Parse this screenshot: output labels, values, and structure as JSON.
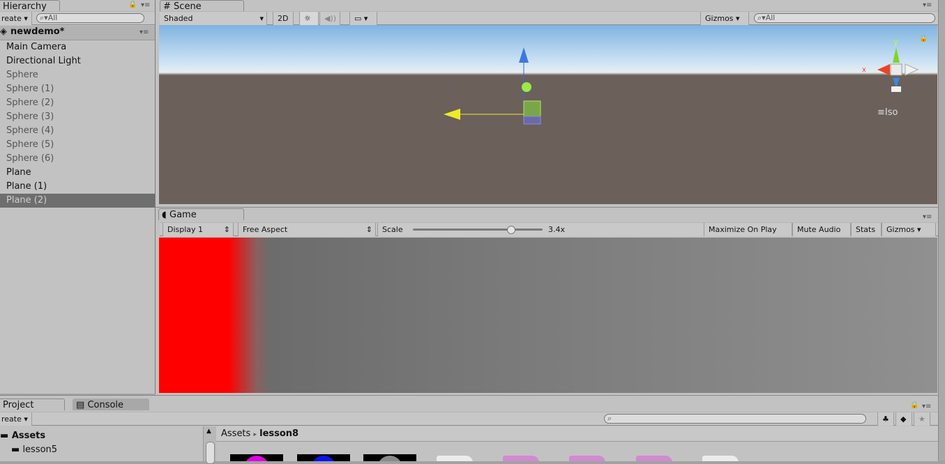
{
  "hierarchy": {
    "tab": "Hierarchy",
    "create": "reate",
    "search_placeholder": "All",
    "scene": "newdemo*",
    "items": [
      {
        "label": "Main Camera",
        "active": true
      },
      {
        "label": "Directional Light",
        "active": true
      },
      {
        "label": "Sphere",
        "active": false
      },
      {
        "label": "Sphere (1)",
        "active": false
      },
      {
        "label": "Sphere (2)",
        "active": false
      },
      {
        "label": "Sphere (3)",
        "active": false
      },
      {
        "label": "Sphere (4)",
        "active": false
      },
      {
        "label": "Sphere (5)",
        "active": false
      },
      {
        "label": "Sphere (6)",
        "active": false
      },
      {
        "label": "Plane",
        "active": true
      },
      {
        "label": "Plane (1)",
        "active": true
      },
      {
        "label": "Plane (2)",
        "active": false,
        "selected": true
      }
    ]
  },
  "scene": {
    "tab": "Scene",
    "shading": "Shaded",
    "mode_2d": "2D",
    "gizmos": "Gizmos",
    "search_placeholder": "All",
    "view_mode": "Iso",
    "axis_y": "y",
    "axis_x": "x"
  },
  "game": {
    "tab": "Game",
    "display": "Display 1",
    "aspect": "Free Aspect",
    "scale_label": "Scale",
    "scale_value": "3.4x",
    "scale_fraction": 0.75,
    "maximize": "Maximize On Play",
    "mute": "Mute Audio",
    "stats": "Stats",
    "gizmos": "Gizmos"
  },
  "project": {
    "tab": "Project",
    "console_tab": "Console",
    "create": "reate",
    "assets": "Assets",
    "folders": [
      "lesson5"
    ],
    "breadcrumb_root": "Assets",
    "breadcrumb_current": "lesson8"
  },
  "colors": {
    "sky": "#b8d8f0",
    "ground": "#6b605a",
    "game_red": "#ff0000",
    "selection": "#6e6e6e"
  }
}
